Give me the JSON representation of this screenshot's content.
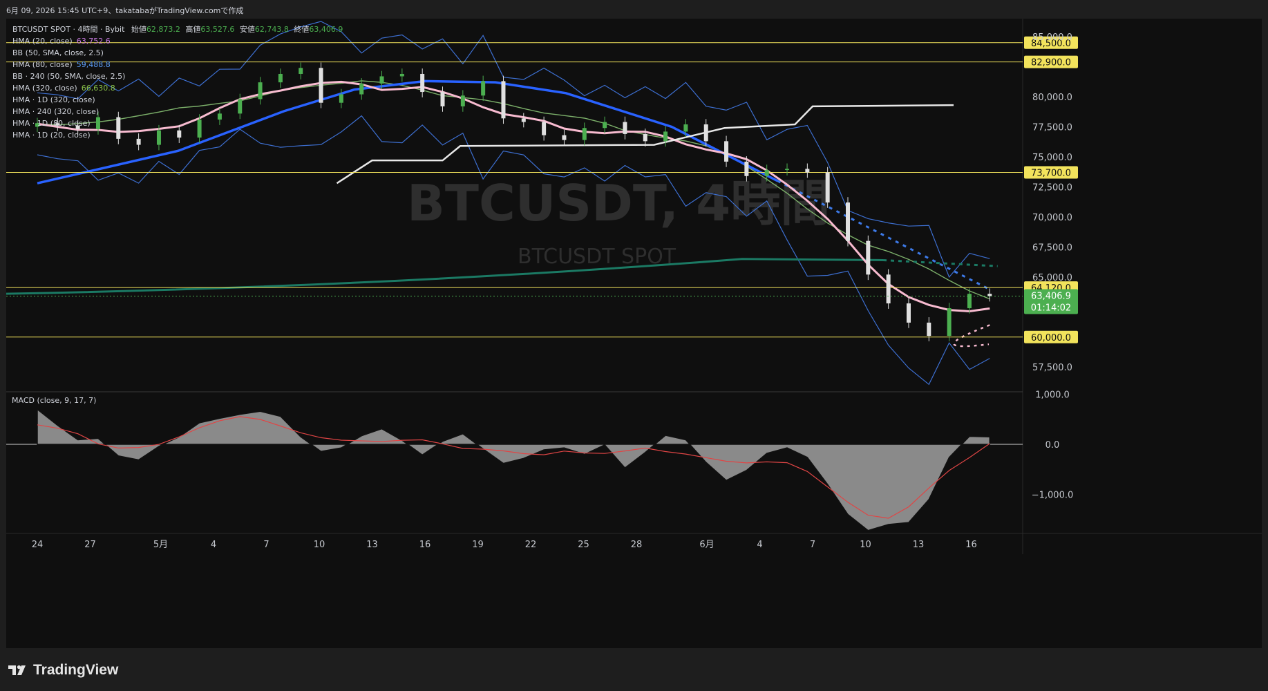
{
  "header": {
    "text": "6月 09, 2026 15:45 UTC+9、takatabaがTradingView.comで作成"
  },
  "legend": {
    "title": "BTCUSDT SPOT · 4時間 · Bybit",
    "ohlc": [
      {
        "label": "始値",
        "value": "62,873.2"
      },
      {
        "label": "高値",
        "value": "63,527.6"
      },
      {
        "label": "安値",
        "value": "62,743.8"
      },
      {
        "label": "終値",
        "value": "63,406.9"
      }
    ],
    "indicators": [
      {
        "label": "HMA (20, close)",
        "value": "63,752.6",
        "color": "#c87ae0"
      },
      {
        "label": "BB (50, SMA, close, 2.5)",
        "value": "",
        "color": "#d1d4dc"
      },
      {
        "label": "HMA (80, close)",
        "value": "59,488.8",
        "color": "#5b9cf6"
      },
      {
        "label": "BB · 240 (50, SMA, close, 2.5)",
        "value": "",
        "color": "#d1d4dc"
      },
      {
        "label": "HMA (320, close)",
        "value": "66,630.8",
        "color": "#8bc34a"
      },
      {
        "label": "HMA · 1D (320, close)",
        "value": "",
        "color": "#d1d4dc"
      },
      {
        "label": "HMA · 240 (320, close)",
        "value": "",
        "color": "#d1d4dc"
      },
      {
        "label": "HMA · 1D (80, close)",
        "value": "",
        "color": "#d1d4dc"
      },
      {
        "label": "HMA · 1D (20, close)",
        "value": "",
        "color": "#d1d4dc"
      }
    ]
  },
  "watermark": {
    "big": "BTCUSDT, 4時間",
    "small": "BTCUSDT SPOT"
  },
  "macd": {
    "label": "MACD (close, 9, 17, 7)"
  },
  "brand": {
    "name": "TradingView"
  },
  "colors": {
    "up": "#26a69a",
    "down": "#ef5350",
    "candle_up": "#4caf50",
    "candle_down": "#e0e0e0",
    "hline": "#f2e35c",
    "price_tag": "#4caf50",
    "hma80": "#2962ff",
    "hma20": "#f8bbd0",
    "teal": "#1b7a64",
    "white_line": "#e8e8e8"
  },
  "chart_data": {
    "type": "candlestick",
    "symbol": "BTCUSDT SPOT",
    "timeframe": "4時間",
    "price_axis": {
      "ticks": [
        "85,000.0",
        "80,000.0",
        "77,500.0",
        "75,000.0",
        "72,500.0",
        "70,000.0",
        "67,500.0",
        "65,000.0",
        "57,500.0"
      ],
      "tick_values": [
        85000,
        80000,
        77500,
        75000,
        72500,
        70000,
        67500,
        65000,
        57500
      ],
      "ylim": [
        55500,
        86500
      ]
    },
    "horizontal_lines": [
      {
        "label": "84,500.0",
        "value": 84500
      },
      {
        "label": "82,900.0",
        "value": 82900
      },
      {
        "label": "73,700.0",
        "value": 73700
      },
      {
        "label": "64,120.0",
        "value": 64120
      },
      {
        "label": "60,000.0",
        "value": 60000
      }
    ],
    "last_price": {
      "label": "63,406.9",
      "value": 63406.9,
      "countdown": "01:14:02"
    },
    "time_axis": {
      "labels": [
        "24",
        "27",
        "5月",
        "4",
        "7",
        "10",
        "13",
        "16",
        "19",
        "22",
        "25",
        "28",
        "6月",
        "4",
        "7",
        "10",
        "13",
        "16"
      ],
      "day_index": [
        0,
        3,
        7,
        10,
        13,
        16,
        19,
        22,
        25,
        28,
        31,
        34,
        38,
        41,
        44,
        47,
        50,
        53
      ]
    },
    "candles_close_approx": [
      [
        0,
        77800
      ],
      [
        1,
        77600
      ],
      [
        2,
        77300
      ],
      [
        3,
        78300
      ],
      [
        4,
        76500
      ],
      [
        5,
        76000
      ],
      [
        6,
        77200
      ],
      [
        7,
        76600
      ],
      [
        8,
        78100
      ],
      [
        9,
        78600
      ],
      [
        10,
        79800
      ],
      [
        11,
        81200
      ],
      [
        12,
        81900
      ],
      [
        13,
        82400
      ],
      [
        14,
        79500
      ],
      [
        15,
        80200
      ],
      [
        16,
        81100
      ],
      [
        17,
        81700
      ],
      [
        18,
        81900
      ],
      [
        19,
        80400
      ],
      [
        20,
        79200
      ],
      [
        21,
        80100
      ],
      [
        22,
        81300
      ],
      [
        23,
        78200
      ],
      [
        24,
        77900
      ],
      [
        25,
        76800
      ],
      [
        26,
        76400
      ],
      [
        27,
        77400
      ],
      [
        28,
        77900
      ],
      [
        29,
        76900
      ],
      [
        30,
        76300
      ],
      [
        31,
        77100
      ],
      [
        32,
        77700
      ],
      [
        33,
        76300
      ],
      [
        34,
        74600
      ],
      [
        35,
        73400
      ],
      [
        36,
        73900
      ],
      [
        37,
        74000
      ],
      [
        38,
        73700
      ],
      [
        39,
        71200
      ],
      [
        40,
        68000
      ],
      [
        41,
        65200
      ],
      [
        42,
        62800
      ],
      [
        43,
        61200
      ],
      [
        44,
        60100
      ],
      [
        45,
        62400
      ],
      [
        46,
        63600
      ],
      [
        47,
        63406.9
      ]
    ],
    "macd": {
      "ticks": [
        "1,000.0",
        "0.0",
        "−1,000.0"
      ],
      "tick_values": [
        1000,
        0,
        -1000
      ],
      "ylim": [
        -1780,
        1050
      ],
      "hist_approx": [
        [
          0,
          700
        ],
        [
          1,
          380
        ],
        [
          2,
          90
        ],
        [
          3,
          120
        ],
        [
          4,
          -230
        ],
        [
          5,
          -310
        ],
        [
          6,
          -40
        ],
        [
          7,
          150
        ],
        [
          8,
          430
        ],
        [
          9,
          520
        ],
        [
          10,
          600
        ],
        [
          11,
          660
        ],
        [
          12,
          560
        ],
        [
          13,
          150
        ],
        [
          14,
          -140
        ],
        [
          15,
          -70
        ],
        [
          16,
          170
        ],
        [
          17,
          310
        ],
        [
          18,
          80
        ],
        [
          19,
          -210
        ],
        [
          20,
          60
        ],
        [
          21,
          210
        ],
        [
          22,
          -90
        ],
        [
          23,
          -380
        ],
        [
          24,
          -280
        ],
        [
          25,
          -110
        ],
        [
          26,
          -70
        ],
        [
          27,
          -200
        ],
        [
          28,
          -10
        ],
        [
          29,
          -470
        ],
        [
          30,
          -160
        ],
        [
          31,
          180
        ],
        [
          32,
          90
        ],
        [
          33,
          -360
        ],
        [
          34,
          -720
        ],
        [
          35,
          -520
        ],
        [
          36,
          -180
        ],
        [
          37,
          -70
        ],
        [
          38,
          -260
        ],
        [
          39,
          -800
        ],
        [
          40,
          -1400
        ],
        [
          41,
          -1720
        ],
        [
          42,
          -1600
        ],
        [
          43,
          -1560
        ],
        [
          44,
          -1100
        ],
        [
          45,
          -260
        ],
        [
          46,
          160
        ],
        [
          47,
          150
        ]
      ]
    }
  }
}
